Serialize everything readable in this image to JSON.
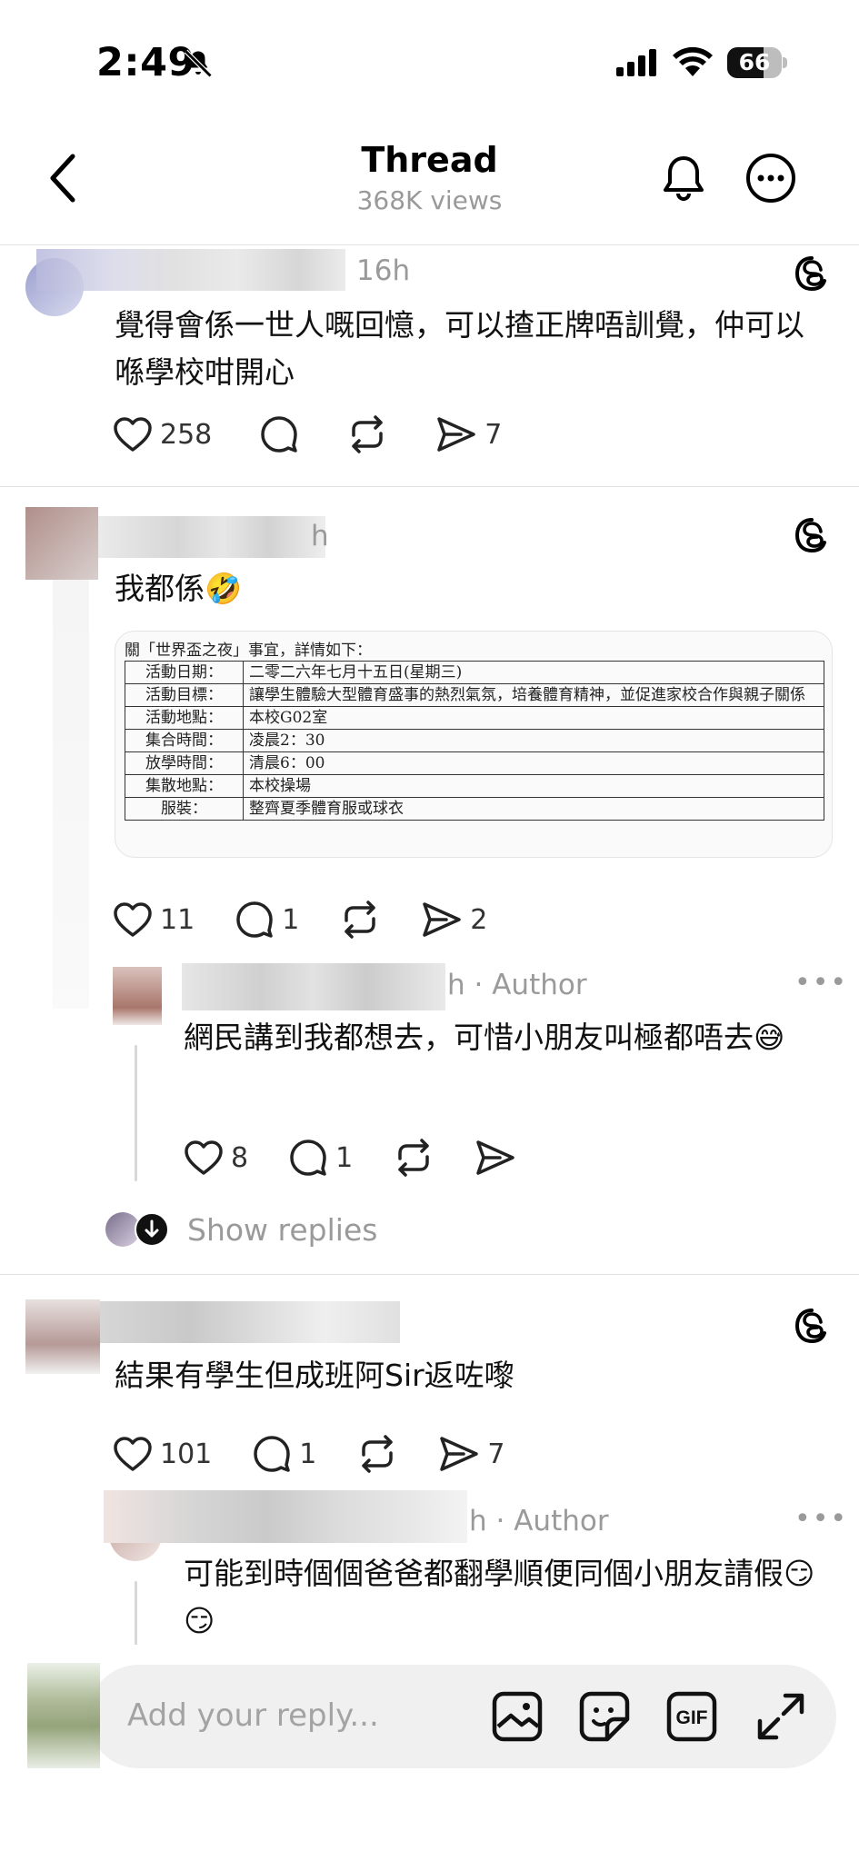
{
  "status_bar": {
    "time": "2:49",
    "battery": "66",
    "battery_level": 0.66
  },
  "header": {
    "title": "Thread",
    "views": "368K views"
  },
  "posts": [
    {
      "time": "16h",
      "text": "覺得會係一世人嘅回憶，可以揸正牌唔訓覺，仲可以喺學校咁開心",
      "likes": "258",
      "shares": "7"
    },
    {
      "time": "h",
      "text": "我都係🤣",
      "likes": "11",
      "replies": "1",
      "shares": "2",
      "image": {
        "heading": "關「世界盃之夜」事宜，詳情如下：",
        "rows": [
          {
            "label": "活動日期：",
            "value": "二零二六年七月十五日(星期三)"
          },
          {
            "label": "活動目標：",
            "value": "讓學生體驗大型體育盛事的熱烈氣氛，培養體育精神，並促進家校合作與親子關係"
          },
          {
            "label": "活動地點：",
            "value": "本校G02室"
          },
          {
            "label": "集合時間：",
            "value": "凌晨2：30"
          },
          {
            "label": "放學時間：",
            "value": "清晨6：00"
          },
          {
            "label": "集散地點：",
            "value": "本校操場"
          },
          {
            "label": "服裝：",
            "value": "整齊夏季體育服或球衣"
          }
        ]
      }
    },
    {
      "text": "結果有學生但成班阿Sir返咗嚟",
      "likes": "101",
      "replies": "1",
      "shares": "7"
    }
  ],
  "author_replies": [
    {
      "time_fragment": "h",
      "author_label": "· Author",
      "text": "網民講到我都想去，可惜小朋友叫極都唔去😅",
      "likes": "8",
      "replies": "1"
    },
    {
      "time_fragment": "h",
      "author_label": "· Author",
      "text": "可能到時個個爸爸都翻學順便同個小朋友請假😏😏"
    }
  ],
  "show_replies": "Show replies",
  "reply_bar": {
    "placeholder": "Add your reply..."
  },
  "icons": [
    "back-icon",
    "bell-icon",
    "more-icon",
    "heart-icon",
    "comment-icon",
    "repost-icon",
    "share-icon",
    "threads-logo-icon",
    "image-icon",
    "sticker-icon",
    "gif-icon",
    "expand-icon"
  ]
}
